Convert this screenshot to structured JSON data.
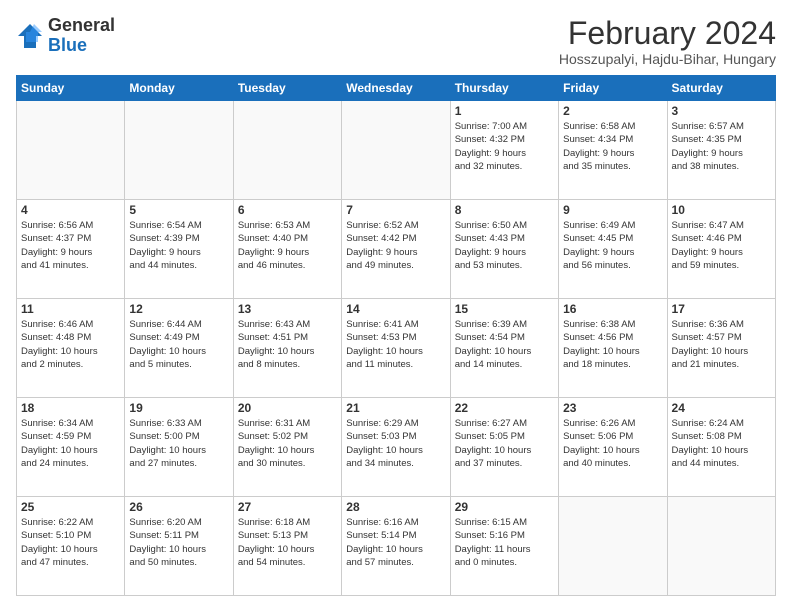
{
  "header": {
    "logo_general": "General",
    "logo_blue": "Blue",
    "month_title": "February 2024",
    "subtitle": "Hosszupalyi, Hajdu-Bihar, Hungary"
  },
  "calendar": {
    "days_of_week": [
      "Sunday",
      "Monday",
      "Tuesday",
      "Wednesday",
      "Thursday",
      "Friday",
      "Saturday"
    ],
    "weeks": [
      [
        {
          "day": "",
          "info": ""
        },
        {
          "day": "",
          "info": ""
        },
        {
          "day": "",
          "info": ""
        },
        {
          "day": "",
          "info": ""
        },
        {
          "day": "1",
          "info": "Sunrise: 7:00 AM\nSunset: 4:32 PM\nDaylight: 9 hours\nand 32 minutes."
        },
        {
          "day": "2",
          "info": "Sunrise: 6:58 AM\nSunset: 4:34 PM\nDaylight: 9 hours\nand 35 minutes."
        },
        {
          "day": "3",
          "info": "Sunrise: 6:57 AM\nSunset: 4:35 PM\nDaylight: 9 hours\nand 38 minutes."
        }
      ],
      [
        {
          "day": "4",
          "info": "Sunrise: 6:56 AM\nSunset: 4:37 PM\nDaylight: 9 hours\nand 41 minutes."
        },
        {
          "day": "5",
          "info": "Sunrise: 6:54 AM\nSunset: 4:39 PM\nDaylight: 9 hours\nand 44 minutes."
        },
        {
          "day": "6",
          "info": "Sunrise: 6:53 AM\nSunset: 4:40 PM\nDaylight: 9 hours\nand 46 minutes."
        },
        {
          "day": "7",
          "info": "Sunrise: 6:52 AM\nSunset: 4:42 PM\nDaylight: 9 hours\nand 49 minutes."
        },
        {
          "day": "8",
          "info": "Sunrise: 6:50 AM\nSunset: 4:43 PM\nDaylight: 9 hours\nand 53 minutes."
        },
        {
          "day": "9",
          "info": "Sunrise: 6:49 AM\nSunset: 4:45 PM\nDaylight: 9 hours\nand 56 minutes."
        },
        {
          "day": "10",
          "info": "Sunrise: 6:47 AM\nSunset: 4:46 PM\nDaylight: 9 hours\nand 59 minutes."
        }
      ],
      [
        {
          "day": "11",
          "info": "Sunrise: 6:46 AM\nSunset: 4:48 PM\nDaylight: 10 hours\nand 2 minutes."
        },
        {
          "day": "12",
          "info": "Sunrise: 6:44 AM\nSunset: 4:49 PM\nDaylight: 10 hours\nand 5 minutes."
        },
        {
          "day": "13",
          "info": "Sunrise: 6:43 AM\nSunset: 4:51 PM\nDaylight: 10 hours\nand 8 minutes."
        },
        {
          "day": "14",
          "info": "Sunrise: 6:41 AM\nSunset: 4:53 PM\nDaylight: 10 hours\nand 11 minutes."
        },
        {
          "day": "15",
          "info": "Sunrise: 6:39 AM\nSunset: 4:54 PM\nDaylight: 10 hours\nand 14 minutes."
        },
        {
          "day": "16",
          "info": "Sunrise: 6:38 AM\nSunset: 4:56 PM\nDaylight: 10 hours\nand 18 minutes."
        },
        {
          "day": "17",
          "info": "Sunrise: 6:36 AM\nSunset: 4:57 PM\nDaylight: 10 hours\nand 21 minutes."
        }
      ],
      [
        {
          "day": "18",
          "info": "Sunrise: 6:34 AM\nSunset: 4:59 PM\nDaylight: 10 hours\nand 24 minutes."
        },
        {
          "day": "19",
          "info": "Sunrise: 6:33 AM\nSunset: 5:00 PM\nDaylight: 10 hours\nand 27 minutes."
        },
        {
          "day": "20",
          "info": "Sunrise: 6:31 AM\nSunset: 5:02 PM\nDaylight: 10 hours\nand 30 minutes."
        },
        {
          "day": "21",
          "info": "Sunrise: 6:29 AM\nSunset: 5:03 PM\nDaylight: 10 hours\nand 34 minutes."
        },
        {
          "day": "22",
          "info": "Sunrise: 6:27 AM\nSunset: 5:05 PM\nDaylight: 10 hours\nand 37 minutes."
        },
        {
          "day": "23",
          "info": "Sunrise: 6:26 AM\nSunset: 5:06 PM\nDaylight: 10 hours\nand 40 minutes."
        },
        {
          "day": "24",
          "info": "Sunrise: 6:24 AM\nSunset: 5:08 PM\nDaylight: 10 hours\nand 44 minutes."
        }
      ],
      [
        {
          "day": "25",
          "info": "Sunrise: 6:22 AM\nSunset: 5:10 PM\nDaylight: 10 hours\nand 47 minutes."
        },
        {
          "day": "26",
          "info": "Sunrise: 6:20 AM\nSunset: 5:11 PM\nDaylight: 10 hours\nand 50 minutes."
        },
        {
          "day": "27",
          "info": "Sunrise: 6:18 AM\nSunset: 5:13 PM\nDaylight: 10 hours\nand 54 minutes."
        },
        {
          "day": "28",
          "info": "Sunrise: 6:16 AM\nSunset: 5:14 PM\nDaylight: 10 hours\nand 57 minutes."
        },
        {
          "day": "29",
          "info": "Sunrise: 6:15 AM\nSunset: 5:16 PM\nDaylight: 11 hours\nand 0 minutes."
        },
        {
          "day": "",
          "info": ""
        },
        {
          "day": "",
          "info": ""
        }
      ]
    ]
  }
}
